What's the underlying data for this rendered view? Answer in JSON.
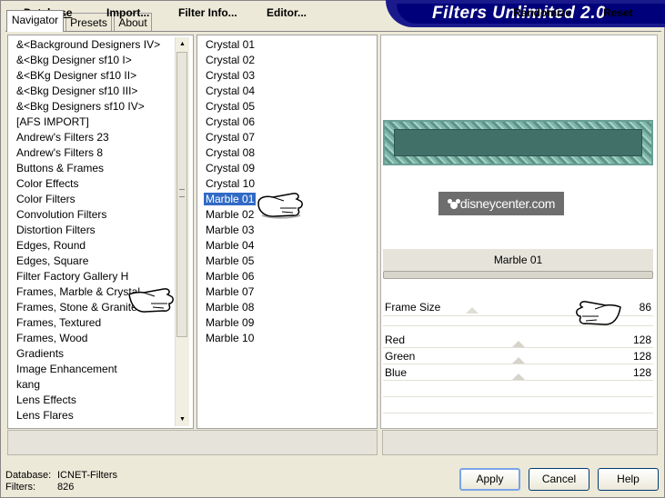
{
  "tabs": [
    "Navigator",
    "Presets",
    "About"
  ],
  "banner_title": "Filters Unlimited 2.0",
  "categories": [
    "&<Background Designers IV>",
    "&<Bkg Designer sf10 I>",
    "&<BKg Designer sf10 II>",
    "&<Bkg Designer sf10 III>",
    "&<Bkg Designers sf10 IV>",
    "[AFS IMPORT]",
    "Andrew's Filters 23",
    "Andrew's Filters 8",
    "Buttons & Frames",
    "Color Effects",
    "Color Filters",
    "Convolution Filters",
    "Distortion Filters",
    "Edges, Round",
    "Edges, Square",
    "Filter Factory Gallery H",
    "Frames, Marble & Crystal",
    "Frames, Stone & Granite",
    "Frames, Textured",
    "Frames, Wood",
    "Gradients",
    "Image Enhancement",
    "kang",
    "Lens Effects",
    "Lens Flares"
  ],
  "filters": [
    "Crystal 01",
    "Crystal 02",
    "Crystal 03",
    "Crystal 04",
    "Crystal 05",
    "Crystal 06",
    "Crystal 07",
    "Crystal 08",
    "Crystal 09",
    "Crystal 10",
    "Marble 01",
    "Marble 02",
    "Marble 03",
    "Marble 04",
    "Marble 05",
    "Marble 06",
    "Marble 07",
    "Marble 08",
    "Marble 09",
    "Marble 10"
  ],
  "selected_filter": "Marble 01",
  "watermark": "disneycenter.com",
  "current_filter_name": "Marble 01",
  "controls": [
    {
      "label": "Frame Size",
      "value": "86"
    },
    {
      "label": "Red",
      "value": "128"
    },
    {
      "label": "Green",
      "value": "128"
    },
    {
      "label": "Blue",
      "value": "128"
    }
  ],
  "bottom_left_buttons": {
    "database": "Database",
    "import": "Import...",
    "filter_info": "Filter Info...",
    "editor": "Editor..."
  },
  "bottom_right_buttons": {
    "randomize": "Randomize",
    "reset": "Reset"
  },
  "status": {
    "database_label": "Database:",
    "database_value": "ICNET-Filters",
    "filters_label": "Filters:",
    "filters_value": "826"
  },
  "dialog_buttons": {
    "apply": "Apply",
    "cancel": "Cancel",
    "help": "Help"
  },
  "colors": {
    "banner": "#00007a",
    "selection": "#316ac5",
    "preview_frame": "#417068"
  }
}
